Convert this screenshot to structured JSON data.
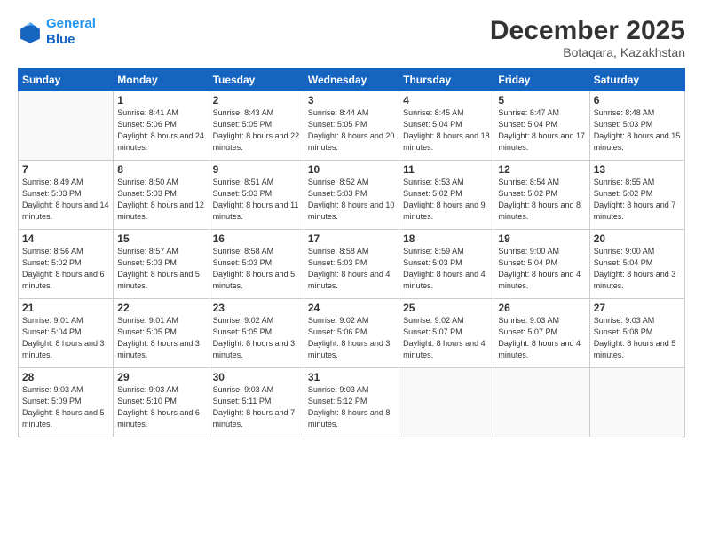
{
  "logo": {
    "line1": "General",
    "line2": "Blue"
  },
  "header": {
    "month": "December 2025",
    "location": "Botaqara, Kazakhstan"
  },
  "days_header": [
    "Sunday",
    "Monday",
    "Tuesday",
    "Wednesday",
    "Thursday",
    "Friday",
    "Saturday"
  ],
  "weeks": [
    [
      {
        "day": "",
        "sunrise": "",
        "sunset": "",
        "daylight": ""
      },
      {
        "day": "1",
        "sunrise": "Sunrise: 8:41 AM",
        "sunset": "Sunset: 5:06 PM",
        "daylight": "Daylight: 8 hours and 24 minutes."
      },
      {
        "day": "2",
        "sunrise": "Sunrise: 8:43 AM",
        "sunset": "Sunset: 5:05 PM",
        "daylight": "Daylight: 8 hours and 22 minutes."
      },
      {
        "day": "3",
        "sunrise": "Sunrise: 8:44 AM",
        "sunset": "Sunset: 5:05 PM",
        "daylight": "Daylight: 8 hours and 20 minutes."
      },
      {
        "day": "4",
        "sunrise": "Sunrise: 8:45 AM",
        "sunset": "Sunset: 5:04 PM",
        "daylight": "Daylight: 8 hours and 18 minutes."
      },
      {
        "day": "5",
        "sunrise": "Sunrise: 8:47 AM",
        "sunset": "Sunset: 5:04 PM",
        "daylight": "Daylight: 8 hours and 17 minutes."
      },
      {
        "day": "6",
        "sunrise": "Sunrise: 8:48 AM",
        "sunset": "Sunset: 5:03 PM",
        "daylight": "Daylight: 8 hours and 15 minutes."
      }
    ],
    [
      {
        "day": "7",
        "sunrise": "Sunrise: 8:49 AM",
        "sunset": "Sunset: 5:03 PM",
        "daylight": "Daylight: 8 hours and 14 minutes."
      },
      {
        "day": "8",
        "sunrise": "Sunrise: 8:50 AM",
        "sunset": "Sunset: 5:03 PM",
        "daylight": "Daylight: 8 hours and 12 minutes."
      },
      {
        "day": "9",
        "sunrise": "Sunrise: 8:51 AM",
        "sunset": "Sunset: 5:03 PM",
        "daylight": "Daylight: 8 hours and 11 minutes."
      },
      {
        "day": "10",
        "sunrise": "Sunrise: 8:52 AM",
        "sunset": "Sunset: 5:03 PM",
        "daylight": "Daylight: 8 hours and 10 minutes."
      },
      {
        "day": "11",
        "sunrise": "Sunrise: 8:53 AM",
        "sunset": "Sunset: 5:02 PM",
        "daylight": "Daylight: 8 hours and 9 minutes."
      },
      {
        "day": "12",
        "sunrise": "Sunrise: 8:54 AM",
        "sunset": "Sunset: 5:02 PM",
        "daylight": "Daylight: 8 hours and 8 minutes."
      },
      {
        "day": "13",
        "sunrise": "Sunrise: 8:55 AM",
        "sunset": "Sunset: 5:02 PM",
        "daylight": "Daylight: 8 hours and 7 minutes."
      }
    ],
    [
      {
        "day": "14",
        "sunrise": "Sunrise: 8:56 AM",
        "sunset": "Sunset: 5:02 PM",
        "daylight": "Daylight: 8 hours and 6 minutes."
      },
      {
        "day": "15",
        "sunrise": "Sunrise: 8:57 AM",
        "sunset": "Sunset: 5:03 PM",
        "daylight": "Daylight: 8 hours and 5 minutes."
      },
      {
        "day": "16",
        "sunrise": "Sunrise: 8:58 AM",
        "sunset": "Sunset: 5:03 PM",
        "daylight": "Daylight: 8 hours and 5 minutes."
      },
      {
        "day": "17",
        "sunrise": "Sunrise: 8:58 AM",
        "sunset": "Sunset: 5:03 PM",
        "daylight": "Daylight: 8 hours and 4 minutes."
      },
      {
        "day": "18",
        "sunrise": "Sunrise: 8:59 AM",
        "sunset": "Sunset: 5:03 PM",
        "daylight": "Daylight: 8 hours and 4 minutes."
      },
      {
        "day": "19",
        "sunrise": "Sunrise: 9:00 AM",
        "sunset": "Sunset: 5:04 PM",
        "daylight": "Daylight: 8 hours and 4 minutes."
      },
      {
        "day": "20",
        "sunrise": "Sunrise: 9:00 AM",
        "sunset": "Sunset: 5:04 PM",
        "daylight": "Daylight: 8 hours and 3 minutes."
      }
    ],
    [
      {
        "day": "21",
        "sunrise": "Sunrise: 9:01 AM",
        "sunset": "Sunset: 5:04 PM",
        "daylight": "Daylight: 8 hours and 3 minutes."
      },
      {
        "day": "22",
        "sunrise": "Sunrise: 9:01 AM",
        "sunset": "Sunset: 5:05 PM",
        "daylight": "Daylight: 8 hours and 3 minutes."
      },
      {
        "day": "23",
        "sunrise": "Sunrise: 9:02 AM",
        "sunset": "Sunset: 5:05 PM",
        "daylight": "Daylight: 8 hours and 3 minutes."
      },
      {
        "day": "24",
        "sunrise": "Sunrise: 9:02 AM",
        "sunset": "Sunset: 5:06 PM",
        "daylight": "Daylight: 8 hours and 3 minutes."
      },
      {
        "day": "25",
        "sunrise": "Sunrise: 9:02 AM",
        "sunset": "Sunset: 5:07 PM",
        "daylight": "Daylight: 8 hours and 4 minutes."
      },
      {
        "day": "26",
        "sunrise": "Sunrise: 9:03 AM",
        "sunset": "Sunset: 5:07 PM",
        "daylight": "Daylight: 8 hours and 4 minutes."
      },
      {
        "day": "27",
        "sunrise": "Sunrise: 9:03 AM",
        "sunset": "Sunset: 5:08 PM",
        "daylight": "Daylight: 8 hours and 5 minutes."
      }
    ],
    [
      {
        "day": "28",
        "sunrise": "Sunrise: 9:03 AM",
        "sunset": "Sunset: 5:09 PM",
        "daylight": "Daylight: 8 hours and 5 minutes."
      },
      {
        "day": "29",
        "sunrise": "Sunrise: 9:03 AM",
        "sunset": "Sunset: 5:10 PM",
        "daylight": "Daylight: 8 hours and 6 minutes."
      },
      {
        "day": "30",
        "sunrise": "Sunrise: 9:03 AM",
        "sunset": "Sunset: 5:11 PM",
        "daylight": "Daylight: 8 hours and 7 minutes."
      },
      {
        "day": "31",
        "sunrise": "Sunrise: 9:03 AM",
        "sunset": "Sunset: 5:12 PM",
        "daylight": "Daylight: 8 hours and 8 minutes."
      },
      {
        "day": "",
        "sunrise": "",
        "sunset": "",
        "daylight": ""
      },
      {
        "day": "",
        "sunrise": "",
        "sunset": "",
        "daylight": ""
      },
      {
        "day": "",
        "sunrise": "",
        "sunset": "",
        "daylight": ""
      }
    ]
  ]
}
